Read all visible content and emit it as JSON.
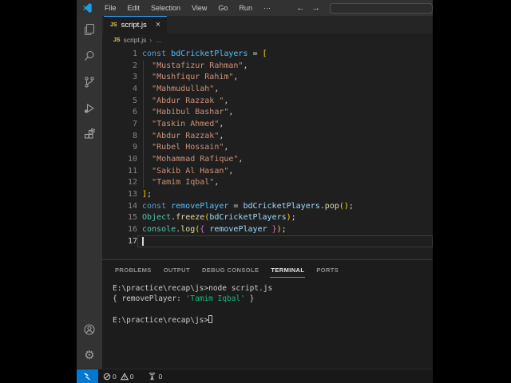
{
  "app": {
    "menu_items": [
      "File",
      "Edit",
      "Selection",
      "View",
      "Go",
      "Run",
      "⋯"
    ],
    "nav_back": "←",
    "nav_forward": "→",
    "command_center_value": ""
  },
  "tab": {
    "icon": "JS",
    "label": "script.js",
    "close": "×"
  },
  "breadcrumb": {
    "icon": "JS",
    "file": "script.js",
    "sep": "›",
    "more": "…"
  },
  "editor": {
    "lines": [
      {
        "n": "1",
        "tokens": [
          {
            "s": "const ",
            "c": "kw"
          },
          {
            "s": "bdCricketPlayers",
            "c": "cvar"
          },
          {
            "s": " = "
          },
          {
            "s": "[",
            "c": "b1"
          }
        ]
      },
      {
        "n": "2",
        "tokens": [
          {
            "s": "  "
          },
          {
            "s": "\"Mustafizur Rahman\"",
            "c": "str"
          },
          {
            "s": ","
          }
        ]
      },
      {
        "n": "3",
        "tokens": [
          {
            "s": "  "
          },
          {
            "s": "\"Mushfiqur Rahim\"",
            "c": "str"
          },
          {
            "s": ","
          }
        ]
      },
      {
        "n": "4",
        "tokens": [
          {
            "s": "  "
          },
          {
            "s": "\"Mahmudullah\"",
            "c": "str"
          },
          {
            "s": ","
          }
        ]
      },
      {
        "n": "5",
        "tokens": [
          {
            "s": "  "
          },
          {
            "s": "\"Abdur Razzak \"",
            "c": "str"
          },
          {
            "s": ","
          }
        ]
      },
      {
        "n": "6",
        "tokens": [
          {
            "s": "  "
          },
          {
            "s": "\"Habibul Bashar\"",
            "c": "str"
          },
          {
            "s": ","
          }
        ]
      },
      {
        "n": "7",
        "tokens": [
          {
            "s": "  "
          },
          {
            "s": "\"Taskin Ahmed\"",
            "c": "str"
          },
          {
            "s": ","
          }
        ]
      },
      {
        "n": "8",
        "tokens": [
          {
            "s": "  "
          },
          {
            "s": "\"Abdur Razzak\"",
            "c": "str"
          },
          {
            "s": ","
          }
        ]
      },
      {
        "n": "9",
        "tokens": [
          {
            "s": "  "
          },
          {
            "s": "\"Rubel Hossain\"",
            "c": "str"
          },
          {
            "s": ","
          }
        ]
      },
      {
        "n": "10",
        "tokens": [
          {
            "s": "  "
          },
          {
            "s": "\"Mohammad Rafique\"",
            "c": "str"
          },
          {
            "s": ","
          }
        ]
      },
      {
        "n": "11",
        "tokens": [
          {
            "s": "  "
          },
          {
            "s": "\"Sakib Al Hasan\"",
            "c": "str"
          },
          {
            "s": ","
          }
        ]
      },
      {
        "n": "12",
        "tokens": [
          {
            "s": "  "
          },
          {
            "s": "\"Tamim Iqbal\"",
            "c": "str"
          },
          {
            "s": ","
          }
        ]
      },
      {
        "n": "13",
        "tokens": [
          {
            "s": "]",
            "c": "b1"
          },
          {
            "s": ";"
          }
        ]
      },
      {
        "n": "14",
        "tokens": [
          {
            "s": "const ",
            "c": "kw"
          },
          {
            "s": "removePlayer",
            "c": "cvar"
          },
          {
            "s": " = "
          },
          {
            "s": "bdCricketPlayers",
            "c": "var"
          },
          {
            "s": "."
          },
          {
            "s": "pop",
            "c": "fn"
          },
          {
            "s": "()",
            "c": "b1"
          },
          {
            "s": ";"
          }
        ]
      },
      {
        "n": "15",
        "tokens": [
          {
            "s": "Object",
            "c": "cls"
          },
          {
            "s": "."
          },
          {
            "s": "freeze",
            "c": "fn"
          },
          {
            "s": "(",
            "c": "b1"
          },
          {
            "s": "bdCricketPlayers",
            "c": "var"
          },
          {
            "s": ")",
            "c": "b1"
          },
          {
            "s": ";"
          }
        ]
      },
      {
        "n": "16",
        "tokens": [
          {
            "s": "console",
            "c": "cls"
          },
          {
            "s": "."
          },
          {
            "s": "log",
            "c": "fn"
          },
          {
            "s": "(",
            "c": "b1"
          },
          {
            "s": "{",
            "c": "b2"
          },
          {
            "s": " removePlayer ",
            "c": "var"
          },
          {
            "s": "}",
            "c": "b2"
          },
          {
            "s": ")",
            "c": "b1"
          },
          {
            "s": ";"
          }
        ]
      },
      {
        "n": "17",
        "tokens": [],
        "current": true,
        "cursor": true
      }
    ]
  },
  "panel": {
    "tabs": [
      "PROBLEMS",
      "OUTPUT",
      "DEBUG CONSOLE",
      "TERMINAL",
      "PORTS"
    ],
    "active_tab": "TERMINAL"
  },
  "terminal": {
    "lines": [
      {
        "tokens": [
          {
            "s": "E:\\practice\\recap\\js>node script.js"
          }
        ]
      },
      {
        "tokens": [
          {
            "s": "{ removePlayer: "
          },
          {
            "s": "'Tamim Iqbal'",
            "c": "tgreen"
          },
          {
            "s": " }"
          }
        ]
      },
      {
        "tokens": []
      },
      {
        "tokens": [
          {
            "s": "E:\\practice\\recap\\js>"
          }
        ],
        "cursor": true
      }
    ]
  },
  "status": {
    "errors": "0",
    "warnings": "0",
    "ports": "0"
  },
  "activity_bar": {
    "top_icons": [
      "explorer-icon",
      "search-icon",
      "source-control-icon",
      "run-debug-icon",
      "extensions-icon"
    ],
    "bottom_icons": [
      "account-icon",
      "settings-gear-icon"
    ]
  },
  "colors": {
    "accent_blue": "#0078d4",
    "tab_active_border": "#2e9cf5",
    "keyword": "#569cd6",
    "const_name": "#4fc1ff",
    "variable": "#9cdcfe",
    "string": "#ce9178",
    "bracket_gold": "#ffd700",
    "bracket_purple": "#da70d6",
    "class_name": "#4ec9b0",
    "function_name": "#dcdcaa",
    "terminal_green": "#0dbc79",
    "editor_bg": "#1f1f1f",
    "titlebar_bg": "#323233",
    "activitybar_bg": "#333333"
  }
}
